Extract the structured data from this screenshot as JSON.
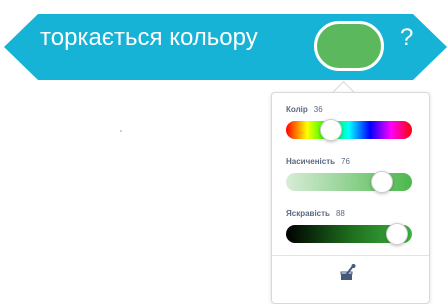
{
  "block": {
    "text": "торкається кольору",
    "question": "?",
    "color": "#17b3d7",
    "selected_color": "#5cb85c"
  },
  "picker": {
    "sliders": [
      {
        "label": "Колір",
        "value": "36",
        "fraction": 0.36
      },
      {
        "label": "Насиченість",
        "value": "76",
        "fraction": 0.76
      },
      {
        "label": "Яскравість",
        "value": "88",
        "fraction": 0.88
      }
    ],
    "eyedropper_icon": "eyedropper-icon"
  }
}
